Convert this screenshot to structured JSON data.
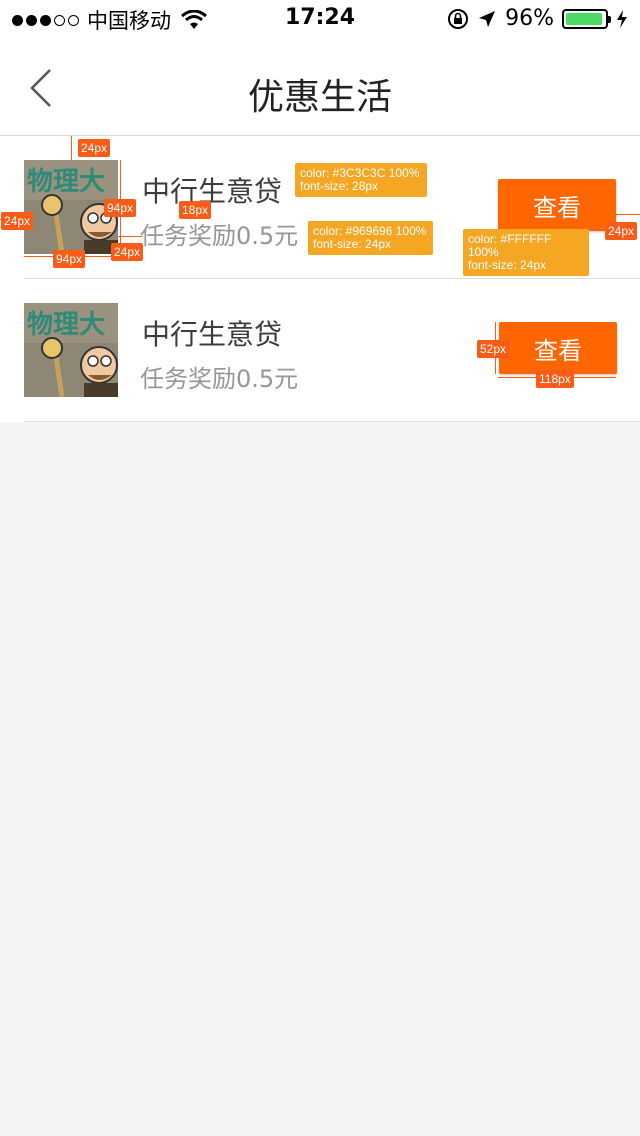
{
  "status_bar": {
    "carrier": "中国移动",
    "time": "17:24",
    "battery_text": "96%",
    "battery_level": 0.96,
    "signal_bars_filled": 3,
    "signal_bars_total": 5
  },
  "nav": {
    "back_icon": "chevron-left-icon",
    "title": "优惠生活"
  },
  "items": [
    {
      "name": "中行生意贷",
      "reward": "任务奖励0.5元",
      "button": "查看"
    },
    {
      "name": "中行生意贷",
      "reward": "任务奖励0.5元",
      "button": "查看"
    }
  ],
  "annotations": {
    "measures": [
      "24px",
      "24px",
      "94px",
      "94px",
      "24px",
      "18px",
      "24px",
      "52px",
      "118px"
    ],
    "specs": [
      {
        "line1": "color: #3C3C3C 100%",
        "line2": "font-size: 28px"
      },
      {
        "line1": "color: #969696 100%",
        "line2": "font-size: 24px"
      },
      {
        "line1": "color: #FFFFFF 100%",
        "line2": "font-size: 24px"
      }
    ]
  },
  "colors": {
    "accent": "#ff6600",
    "title_text": "#3c3c3c",
    "sub_text": "#969696",
    "background": "#f4f4f4"
  }
}
